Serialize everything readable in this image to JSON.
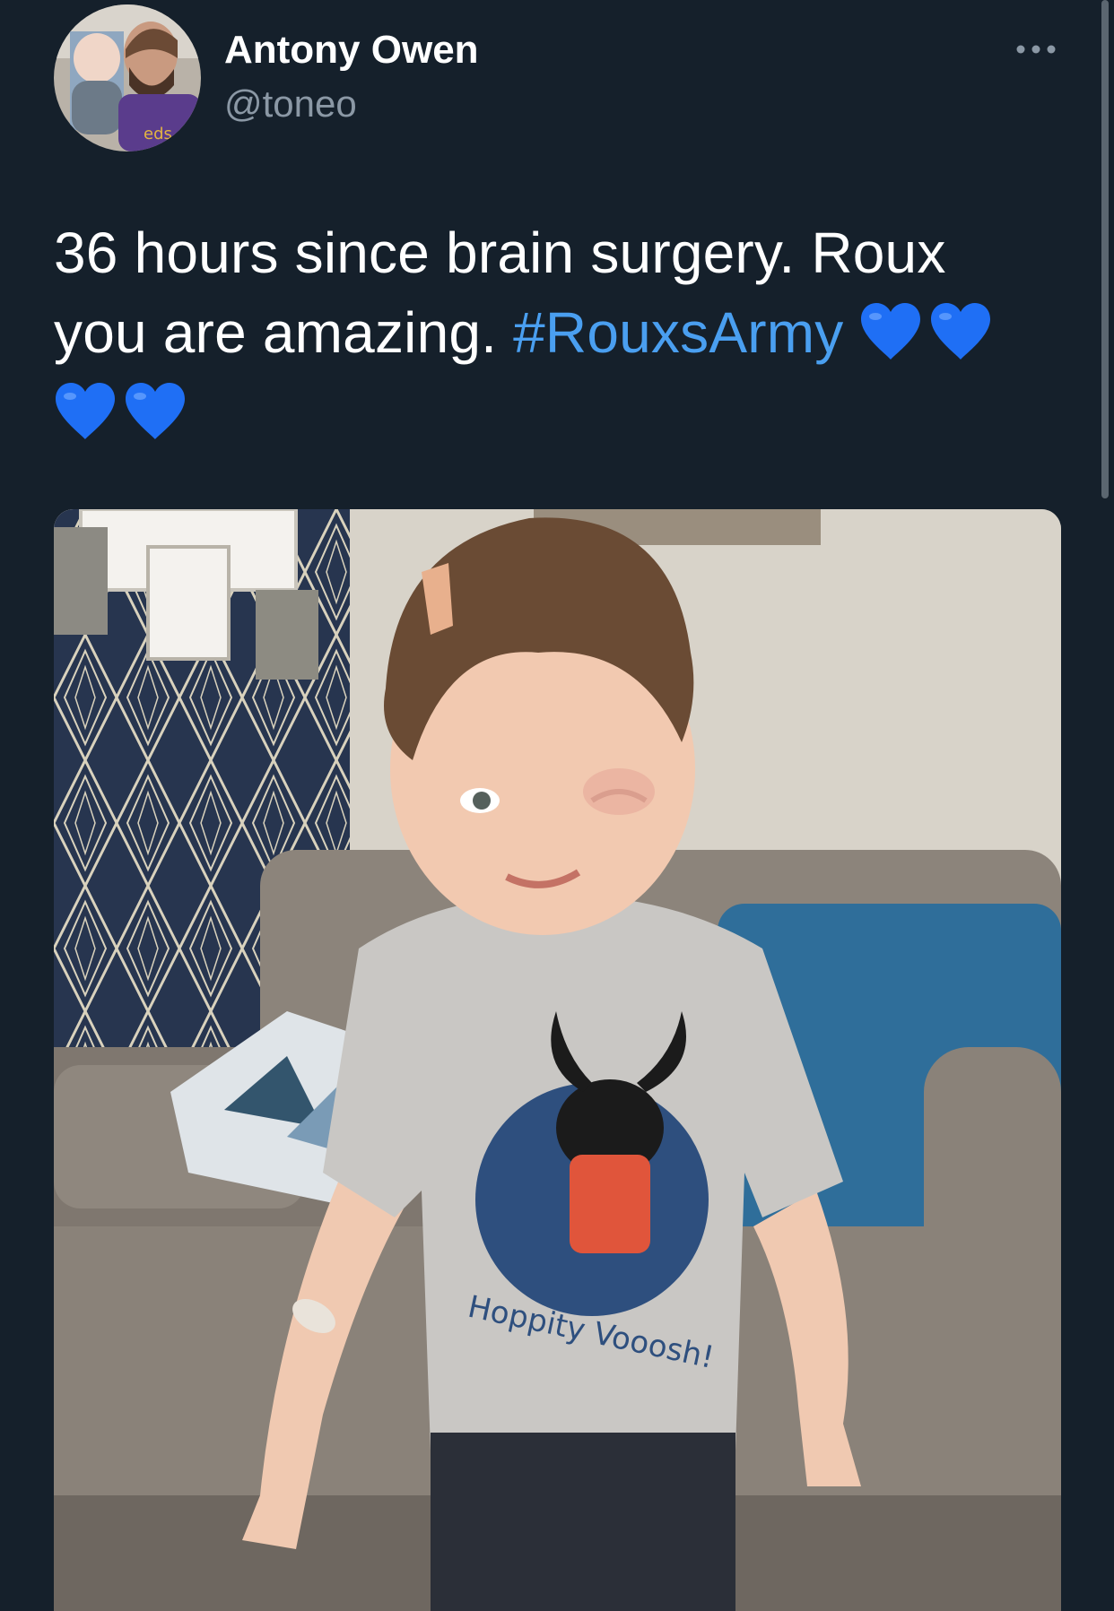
{
  "tweet": {
    "author": {
      "name": "Antony Owen",
      "handle": "@toneo"
    },
    "more_icon": "more-horizontal-icon",
    "text_before_hashtag": "36 hours since brain surgery. Roux you are amazing. ",
    "hashtag": "#RouxsArmy",
    "emoji": [
      "blue-heart",
      "blue-heart",
      "blue-heart",
      "blue-heart"
    ],
    "media": {
      "type": "photo",
      "shirt_text": "Hoppity Vooosh!"
    }
  },
  "colors": {
    "background": "#15202b",
    "text": "#ffffff",
    "secondary_text": "#8b98a5",
    "link": "#4a9ff0",
    "heart": "#1f6ff5"
  }
}
